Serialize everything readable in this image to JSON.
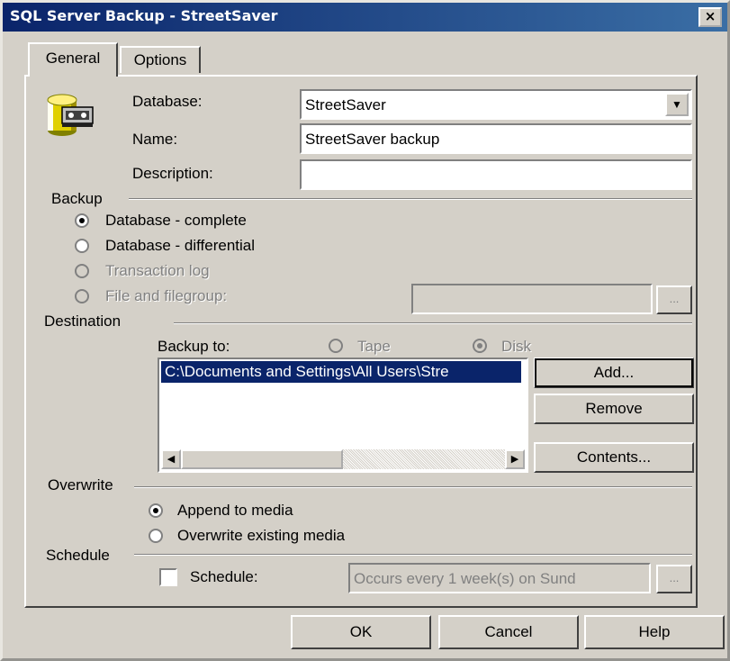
{
  "window": {
    "title": "SQL Server Backup - StreetSaver",
    "close_label": "×"
  },
  "tabs": [
    {
      "label": "General",
      "selected": true
    },
    {
      "label": "Options",
      "selected": false
    }
  ],
  "general": {
    "database_label": "Database:",
    "database_value": "StreetSaver",
    "name_label": "Name:",
    "name_value": "StreetSaver backup",
    "description_label": "Description:",
    "description_value": ""
  },
  "backup": {
    "heading": "Backup",
    "options": [
      {
        "label": "Database - complete",
        "selected": true,
        "enabled": true
      },
      {
        "label": "Database - differential",
        "selected": false,
        "enabled": true
      },
      {
        "label": "Transaction log",
        "selected": false,
        "enabled": false
      },
      {
        "label": "File and filegroup:",
        "selected": false,
        "enabled": false
      }
    ],
    "filegroup_value": "",
    "browse_label": "..."
  },
  "destination": {
    "heading": "Destination",
    "backup_to_label": "Backup to:",
    "tape_label": "Tape",
    "disk_label": "Disk",
    "selected_medium": "Disk",
    "paths": [
      "C:\\Documents and Settings\\All Users\\Stre"
    ],
    "add_label": "Add...",
    "remove_label": "Remove",
    "contents_label": "Contents..."
  },
  "overwrite": {
    "heading": "Overwrite",
    "options": [
      {
        "label": "Append to media",
        "selected": true
      },
      {
        "label": "Overwrite existing media",
        "selected": false
      }
    ]
  },
  "schedule": {
    "heading": "Schedule",
    "checkbox_label": "Schedule:",
    "checked": false,
    "value": "Occurs every 1 week(s) on Sund",
    "browse_label": "..."
  },
  "footer": {
    "ok_label": "OK",
    "cancel_label": "Cancel",
    "help_label": "Help"
  },
  "colors": {
    "face": "#d4d0c8",
    "title_bar": "#0a246a",
    "selection": "#0a246a",
    "disabled_text": "#808080"
  },
  "icons": {
    "database": "database-backup-icon"
  }
}
